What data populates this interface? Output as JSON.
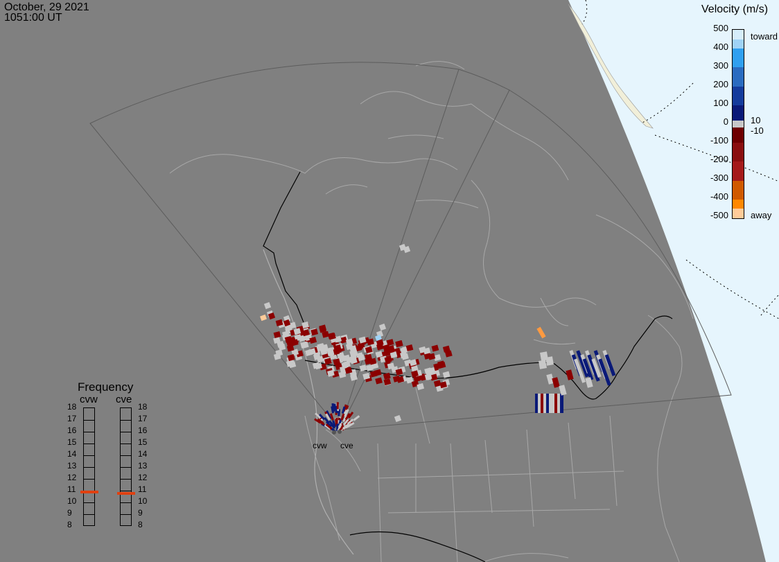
{
  "header": {
    "date": "October, 29 2021",
    "time": "1051:00 UT"
  },
  "colorbar": {
    "title": "Velocity (m/s)",
    "ticks": [
      "500",
      "400",
      "300",
      "200",
      "100",
      "0",
      "-100",
      "-200",
      "-300",
      "-400",
      "-500"
    ],
    "end_top": "toward",
    "end_bottom": "away",
    "inner_top": "10",
    "inner_bottom": "-10",
    "colors": [
      "#d6eefa",
      "#9fd3f6",
      "#2fa0f0",
      "#2a6cc0",
      "#143c9c",
      "#0a1a78",
      "#c8c8c8",
      "#6e0000",
      "#8a0f0f",
      "#a51a1a",
      "#d05a00",
      "#ff8800",
      "#ffcc99"
    ]
  },
  "frequency": {
    "title": "Frequency",
    "radars": [
      {
        "name": "cvw",
        "mhz": 10.8
      },
      {
        "name": "cve",
        "mhz": 10.7
      }
    ],
    "scale": [
      "18",
      "17",
      "16",
      "15",
      "14",
      "13",
      "12",
      "11",
      "10",
      "9",
      "8"
    ]
  },
  "sites": [
    "cvw",
    "cve"
  ],
  "colors": {
    "background": "#808080",
    "polar_cap": "#e6f5fd",
    "land_outline": "#a8a8a8",
    "border": "#000000",
    "fov": "#5c5c5c",
    "gs": "#c8c8c8",
    "away_dark": "#8b0000",
    "toward_dark": "#0a1a78"
  }
}
